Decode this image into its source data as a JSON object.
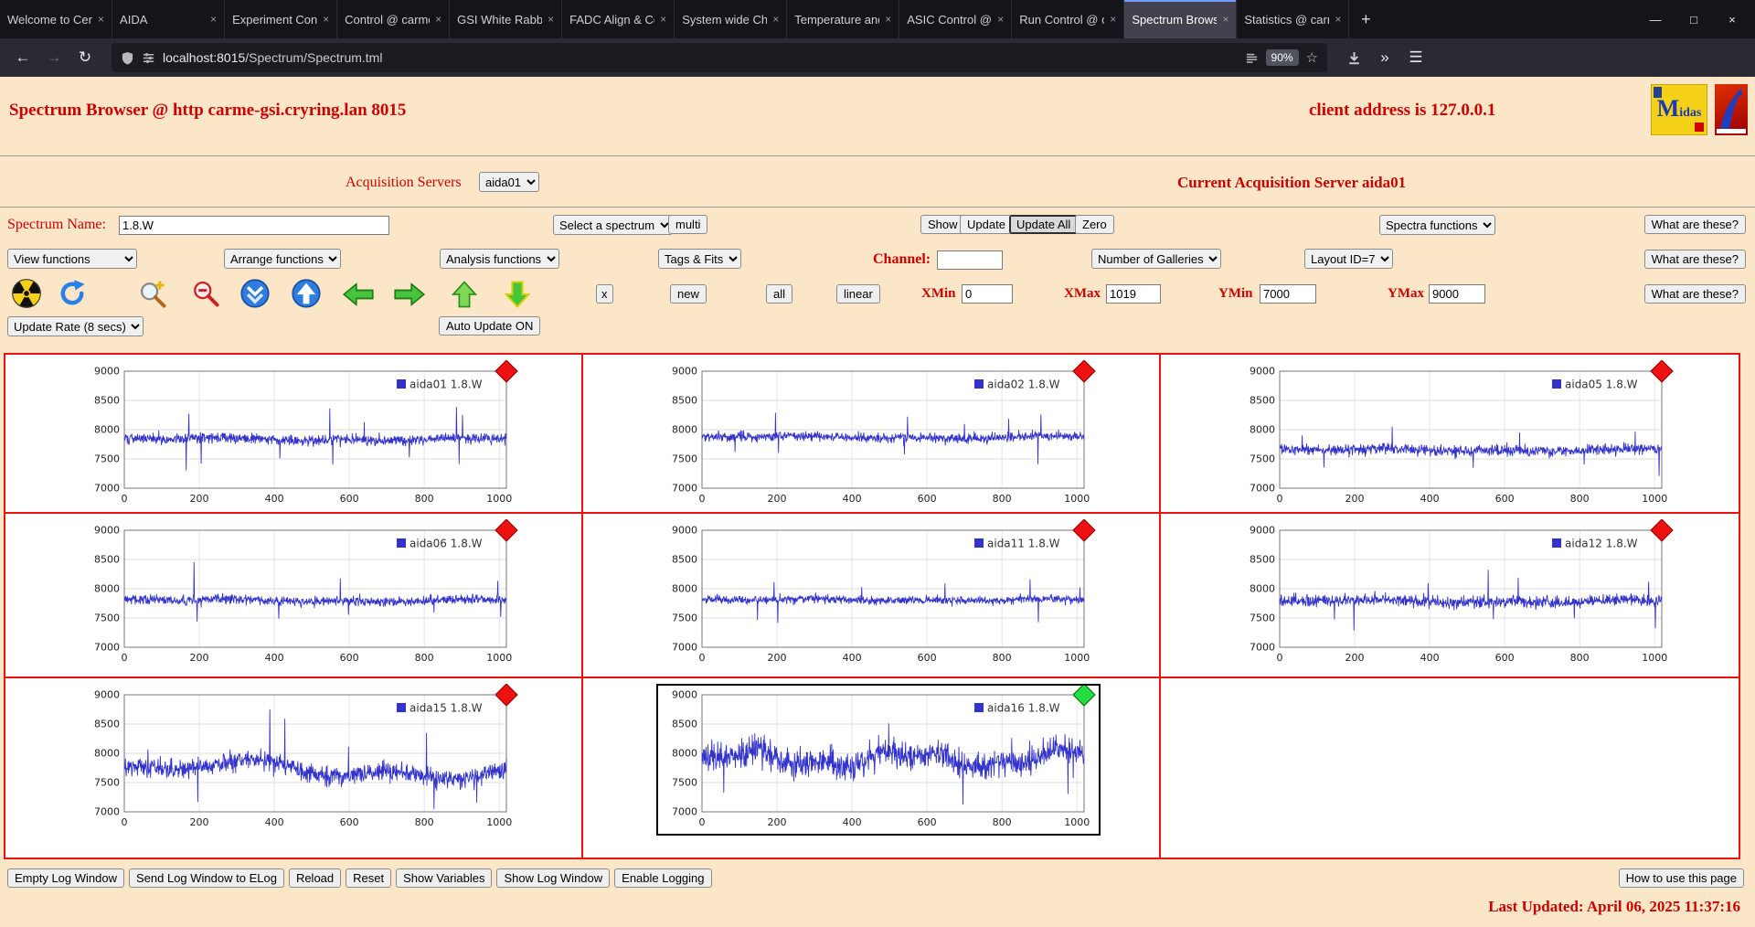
{
  "browser": {
    "tabs": [
      {
        "label": "Welcome to Cen"
      },
      {
        "label": "AIDA"
      },
      {
        "label": "Experiment Cont"
      },
      {
        "label": "Control @ carme"
      },
      {
        "label": "GSI White Rabbit"
      },
      {
        "label": "FADC Align & Co"
      },
      {
        "label": "System wide Che"
      },
      {
        "label": "Temperature and"
      },
      {
        "label": "ASIC Control @ c"
      },
      {
        "label": "Run Control @ c"
      },
      {
        "label": "Spectrum Brows"
      },
      {
        "label": "Statistics @ carm"
      }
    ],
    "active_tab": "Spectrum Brows",
    "new_tab": "+",
    "win_min": "—",
    "win_max": "□",
    "win_close": "×",
    "back": "←",
    "forward": "→",
    "reload": "↻",
    "url_host": "localhost:8015",
    "url_path": "/Spectrum/Spectrum.tml",
    "zoom": "90%",
    "star": "☆",
    "overflow": "»",
    "menu": "☰"
  },
  "header": {
    "title": "Spectrum Browser @ http carme-gsi.cryring.lan 8015",
    "client": "client address is 127.0.0.1",
    "midas_m": "M",
    "midas_rest": "idas"
  },
  "acquisition": {
    "label": "Acquisition Servers",
    "server": "aida01",
    "current": "Current Acquisition Server aida01"
  },
  "controls": {
    "spectrum_name_label": "Spectrum Name:",
    "spectrum_name_value": "1.8.W",
    "select_spectrum": "Select a spectrum",
    "multi": "multi",
    "show": "Show",
    "update": "Update",
    "update_all": "Update All",
    "zero": "Zero",
    "spectra_functions": "Spectra functions",
    "what_are_these": "What are these?",
    "view_functions": "View functions",
    "arrange_functions": "Arrange functions",
    "analysis_functions": "Analysis functions",
    "tags_fits": "Tags & Fits",
    "channel_label": "Channel:",
    "channel_value": "",
    "number_of_galleries": "Number of Galleries",
    "layout_id": "Layout ID=7",
    "x_button": "x",
    "new": "new",
    "all": "all",
    "linear": "linear",
    "xmin_label": "XMin",
    "xmin": "0",
    "xmax_label": "XMax",
    "xmax": "1019",
    "ymin_label": "YMin",
    "ymin": "7000",
    "ymax_label": "YMax",
    "ymax": "9000",
    "update_rate": "Update Rate (8 secs)",
    "auto_update": "Auto Update ON",
    "toolbar_icons": [
      "radioactive",
      "refresh",
      "zoom-in",
      "zoom-out",
      "shrink-vertical",
      "expand-vertical",
      "arrow-left",
      "arrow-right",
      "arrow-up",
      "arrow-down"
    ]
  },
  "chart_data": {
    "type": "line",
    "xlim": [
      0,
      1019
    ],
    "ylim": [
      7000,
      9000
    ],
    "x_ticks": [
      0,
      200,
      400,
      600,
      800,
      1000
    ],
    "y_ticks": [
      7000,
      7500,
      8000,
      8500,
      9000
    ],
    "line_color": "#3333cc",
    "status_colors": {
      "red": "#ee1111",
      "green": "#22dd44"
    },
    "empty_cells": 1,
    "panels": [
      {
        "name": "aida01 1.8.W",
        "status": "red",
        "seed": 101,
        "baseline": 7840,
        "sigma": 45,
        "wander": 30,
        "period": 130,
        "spikes": [
          [
            165,
            -540
          ],
          [
            172,
            430
          ],
          [
            205,
            -310
          ],
          [
            415,
            -270
          ],
          [
            548,
            590
          ],
          [
            556,
            -450
          ],
          [
            640,
            320
          ],
          [
            760,
            -260
          ],
          [
            886,
            560
          ],
          [
            893,
            -420
          ],
          [
            902,
            360
          ]
        ]
      },
      {
        "name": "aida02 1.8.W",
        "status": "red",
        "seed": 102,
        "baseline": 7870,
        "sigma": 40,
        "wander": 28,
        "period": 130,
        "spikes": [
          [
            88,
            -270
          ],
          [
            196,
            450
          ],
          [
            204,
            -320
          ],
          [
            540,
            -300
          ],
          [
            548,
            330
          ],
          [
            700,
            260
          ],
          [
            818,
            300
          ],
          [
            896,
            -460
          ],
          [
            904,
            400
          ]
        ]
      },
      {
        "name": "aida05 1.8.W",
        "status": "red",
        "seed": 103,
        "baseline": 7650,
        "sigma": 45,
        "wander": 28,
        "period": 130,
        "spikes": [
          [
            60,
            280
          ],
          [
            118,
            -260
          ],
          [
            300,
            290
          ],
          [
            516,
            -290
          ],
          [
            640,
            260
          ],
          [
            812,
            -250
          ],
          [
            948,
            330
          ],
          [
            1012,
            -420
          ]
        ]
      },
      {
        "name": "aida06 1.8.W",
        "status": "red",
        "seed": 104,
        "baseline": 7800,
        "sigma": 40,
        "wander": 28,
        "period": 130,
        "spikes": [
          [
            186,
            580
          ],
          [
            194,
            -400
          ],
          [
            412,
            -270
          ],
          [
            576,
            400
          ],
          [
            598,
            -310
          ],
          [
            826,
            -260
          ],
          [
            996,
            350
          ],
          [
            1004,
            -280
          ]
        ]
      },
      {
        "name": "aida11 1.8.W",
        "status": "red",
        "seed": 105,
        "baseline": 7810,
        "sigma": 35,
        "wander": 25,
        "period": 130,
        "spikes": [
          [
            148,
            -340
          ],
          [
            192,
            300
          ],
          [
            202,
            -400
          ],
          [
            426,
            250
          ],
          [
            648,
            280
          ],
          [
            875,
            350
          ],
          [
            897,
            -400
          ],
          [
            1008,
            260
          ]
        ]
      },
      {
        "name": "aida12 1.8.W",
        "status": "red",
        "seed": 106,
        "baseline": 7790,
        "sigma": 50,
        "wander": 30,
        "period": 130,
        "spikes": [
          [
            146,
            -400
          ],
          [
            198,
            -540
          ],
          [
            396,
            300
          ],
          [
            556,
            520
          ],
          [
            570,
            -350
          ],
          [
            636,
            450
          ],
          [
            786,
            -310
          ],
          [
            984,
            340
          ],
          [
            1002,
            -450
          ]
        ]
      },
      {
        "name": "aida15 1.8.W",
        "status": "red",
        "seed": 107,
        "baseline": 7720,
        "sigma": 80,
        "wander": 200,
        "period": 160,
        "spikes": [
          [
            196,
            -560
          ],
          [
            388,
            920
          ],
          [
            398,
            -420
          ],
          [
            428,
            840
          ],
          [
            598,
            320
          ],
          [
            806,
            780
          ],
          [
            826,
            -520
          ],
          [
            940,
            -400
          ]
        ]
      },
      {
        "name": "aida16 1.8.W",
        "status": "green",
        "selected": true,
        "seed": 108,
        "baseline": 7900,
        "sigma": 120,
        "wander": 170,
        "period": 70,
        "spikes": [
          [
            58,
            -520
          ],
          [
            346,
            520
          ],
          [
            498,
            470
          ],
          [
            696,
            -560
          ],
          [
            826,
            420
          ],
          [
            976,
            -640
          ],
          [
            990,
            -500
          ]
        ]
      }
    ]
  },
  "footer": {
    "buttons": [
      "Empty Log Window",
      "Send Log Window to ELog",
      "Reload",
      "Reset",
      "Show Variables",
      "Show Log Window",
      "Enable Logging"
    ],
    "help": "How to use this page",
    "last_updated": "Last Updated: April 06, 2025 11:37:16"
  }
}
